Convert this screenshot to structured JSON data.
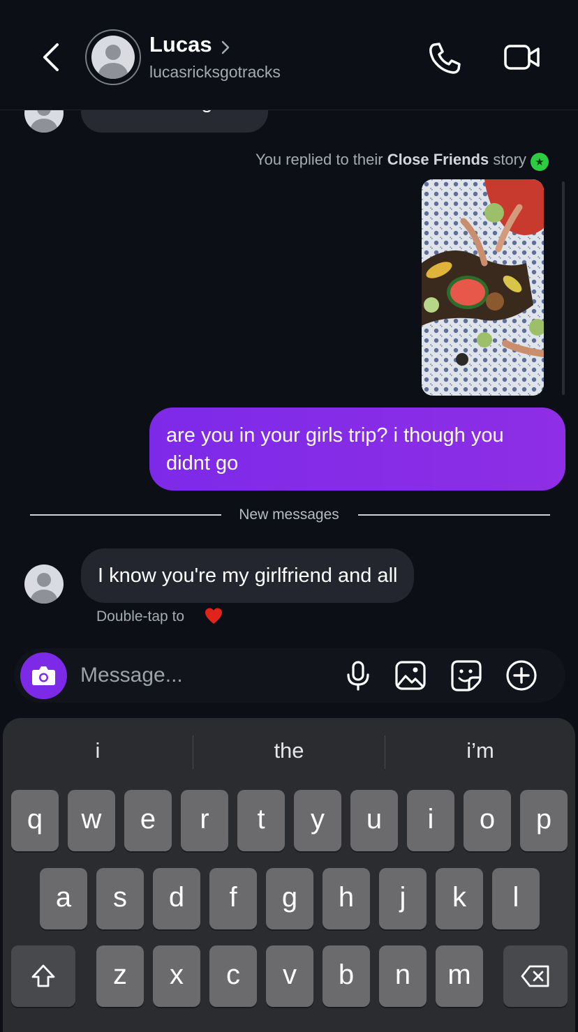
{
  "header": {
    "contact_name": "Lucas",
    "username": "lucasricksgotracks"
  },
  "thread": {
    "partial_message": "I have no signal",
    "story_reply_note": {
      "prefix": "You replied to their ",
      "highlight": "Close Friends",
      "suffix": " story",
      "badge": "★"
    },
    "sent_message": "are you in your girls trip? i though you didnt go",
    "divider_label": "New messages",
    "received_message": "I know you're my girlfriend and all",
    "reaction_hint": "Double-tap to"
  },
  "composer": {
    "placeholder": "Message..."
  },
  "keyboard": {
    "suggestions": [
      "i",
      "the",
      "i’m"
    ],
    "row1": [
      "q",
      "w",
      "e",
      "r",
      "t",
      "y",
      "u",
      "i",
      "o",
      "p"
    ],
    "row2": [
      "a",
      "s",
      "d",
      "f",
      "g",
      "h",
      "j",
      "k",
      "l"
    ],
    "row3": [
      "z",
      "x",
      "c",
      "v",
      "b",
      "n",
      "m"
    ]
  },
  "colors": {
    "background": "#0c0f16",
    "sent_bubble": "#7d2ae8",
    "received_bubble": "#23262e",
    "close_friends_green": "#2ecc40",
    "keyboard_bg": "#2b2c30",
    "key_bg": "#6b6b6e"
  }
}
